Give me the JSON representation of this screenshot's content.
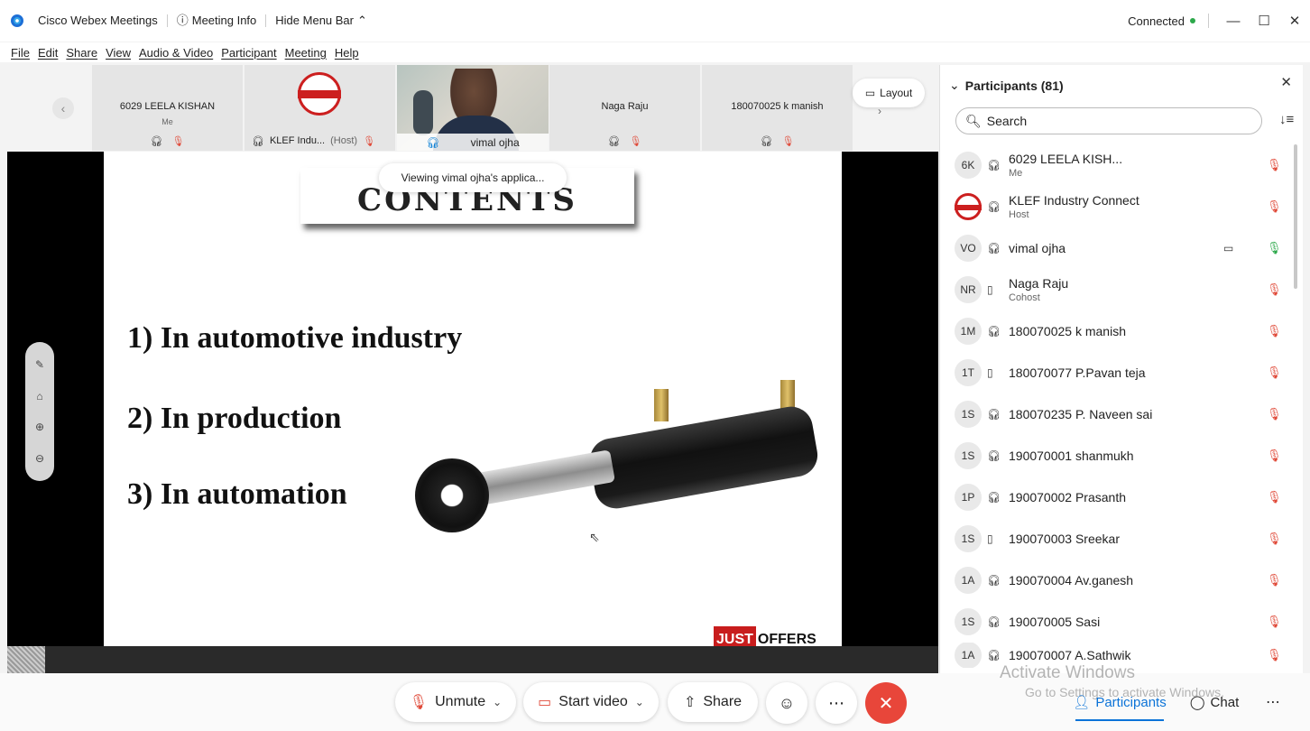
{
  "titlebar": {
    "app_name": "Cisco Webex Meetings",
    "meeting_info": "Meeting Info",
    "hide_menu": "Hide Menu Bar",
    "status": "Connected"
  },
  "menu": [
    "File",
    "Edit",
    "Share",
    "View",
    "Audio & Video",
    "Participant",
    "Meeting",
    "Help"
  ],
  "strip": {
    "thumbs": [
      {
        "name": "6029 LEELA KISHAN",
        "sub": "Me"
      },
      {
        "name": "KLEF Indu...",
        "role": "(Host)"
      },
      {
        "name": "vimal ojha"
      },
      {
        "name": "Naga Raju"
      },
      {
        "name": "180070025 k manish"
      }
    ],
    "layout_label": "Layout"
  },
  "share": {
    "viewing": "Viewing vimal ojha's applica...",
    "slide_title": "CONTENTS",
    "bullets": [
      "1) In automotive industry",
      "2) In production",
      "3) In automation"
    ],
    "logo_red": "JUST",
    "logo_black": "OFFERS"
  },
  "controls": {
    "unmute": "Unmute",
    "start_video": "Start video",
    "share": "Share",
    "participants": "Participants",
    "chat": "Chat"
  },
  "watermark": {
    "line1": "Activate Windows",
    "line2": "Go to Settings to activate Windows."
  },
  "panel": {
    "title": "Participants (81)",
    "search_placeholder": "Search",
    "participants": [
      {
        "initials": "6K",
        "name": "6029 LEELA KISH...",
        "role": "Me",
        "device": "headset",
        "mic": "muted"
      },
      {
        "initials": "",
        "name": "KLEF Industry Connect",
        "role": "Host",
        "device": "headset",
        "mic": "muted"
      },
      {
        "initials": "VO",
        "name": "vimal ojha",
        "role": "",
        "device": "headset",
        "mic": "on",
        "video": true
      },
      {
        "initials": "NR",
        "name": "Naga Raju",
        "role": "Cohost",
        "device": "phone",
        "mic": "muted"
      },
      {
        "initials": "1M",
        "name": "180070025 k manish",
        "role": "",
        "device": "headset",
        "mic": "muted"
      },
      {
        "initials": "1T",
        "name": "180070077 P.Pavan teja",
        "role": "",
        "device": "phone",
        "mic": "muted"
      },
      {
        "initials": "1S",
        "name": "180070235 P. Naveen sai",
        "role": "",
        "device": "headset",
        "mic": "muted"
      },
      {
        "initials": "1S",
        "name": "190070001 shanmukh",
        "role": "",
        "device": "headset",
        "mic": "muted"
      },
      {
        "initials": "1P",
        "name": "190070002 Prasanth",
        "role": "",
        "device": "headset",
        "mic": "muted"
      },
      {
        "initials": "1S",
        "name": "190070003 Sreekar",
        "role": "",
        "device": "phone",
        "mic": "muted"
      },
      {
        "initials": "1A",
        "name": "190070004 Av.ganesh",
        "role": "",
        "device": "headset",
        "mic": "muted"
      },
      {
        "initials": "1S",
        "name": "190070005 Sasi",
        "role": "",
        "device": "headset",
        "mic": "muted"
      },
      {
        "initials": "1A",
        "name": "190070007 A.Sathwik",
        "role": "",
        "device": "headset",
        "mic": "muted"
      }
    ]
  },
  "colors": {
    "accent": "#0b73d8",
    "end_call": "#e8463a",
    "mute_red": "#e04a39",
    "connected_green": "#2ca84a"
  }
}
